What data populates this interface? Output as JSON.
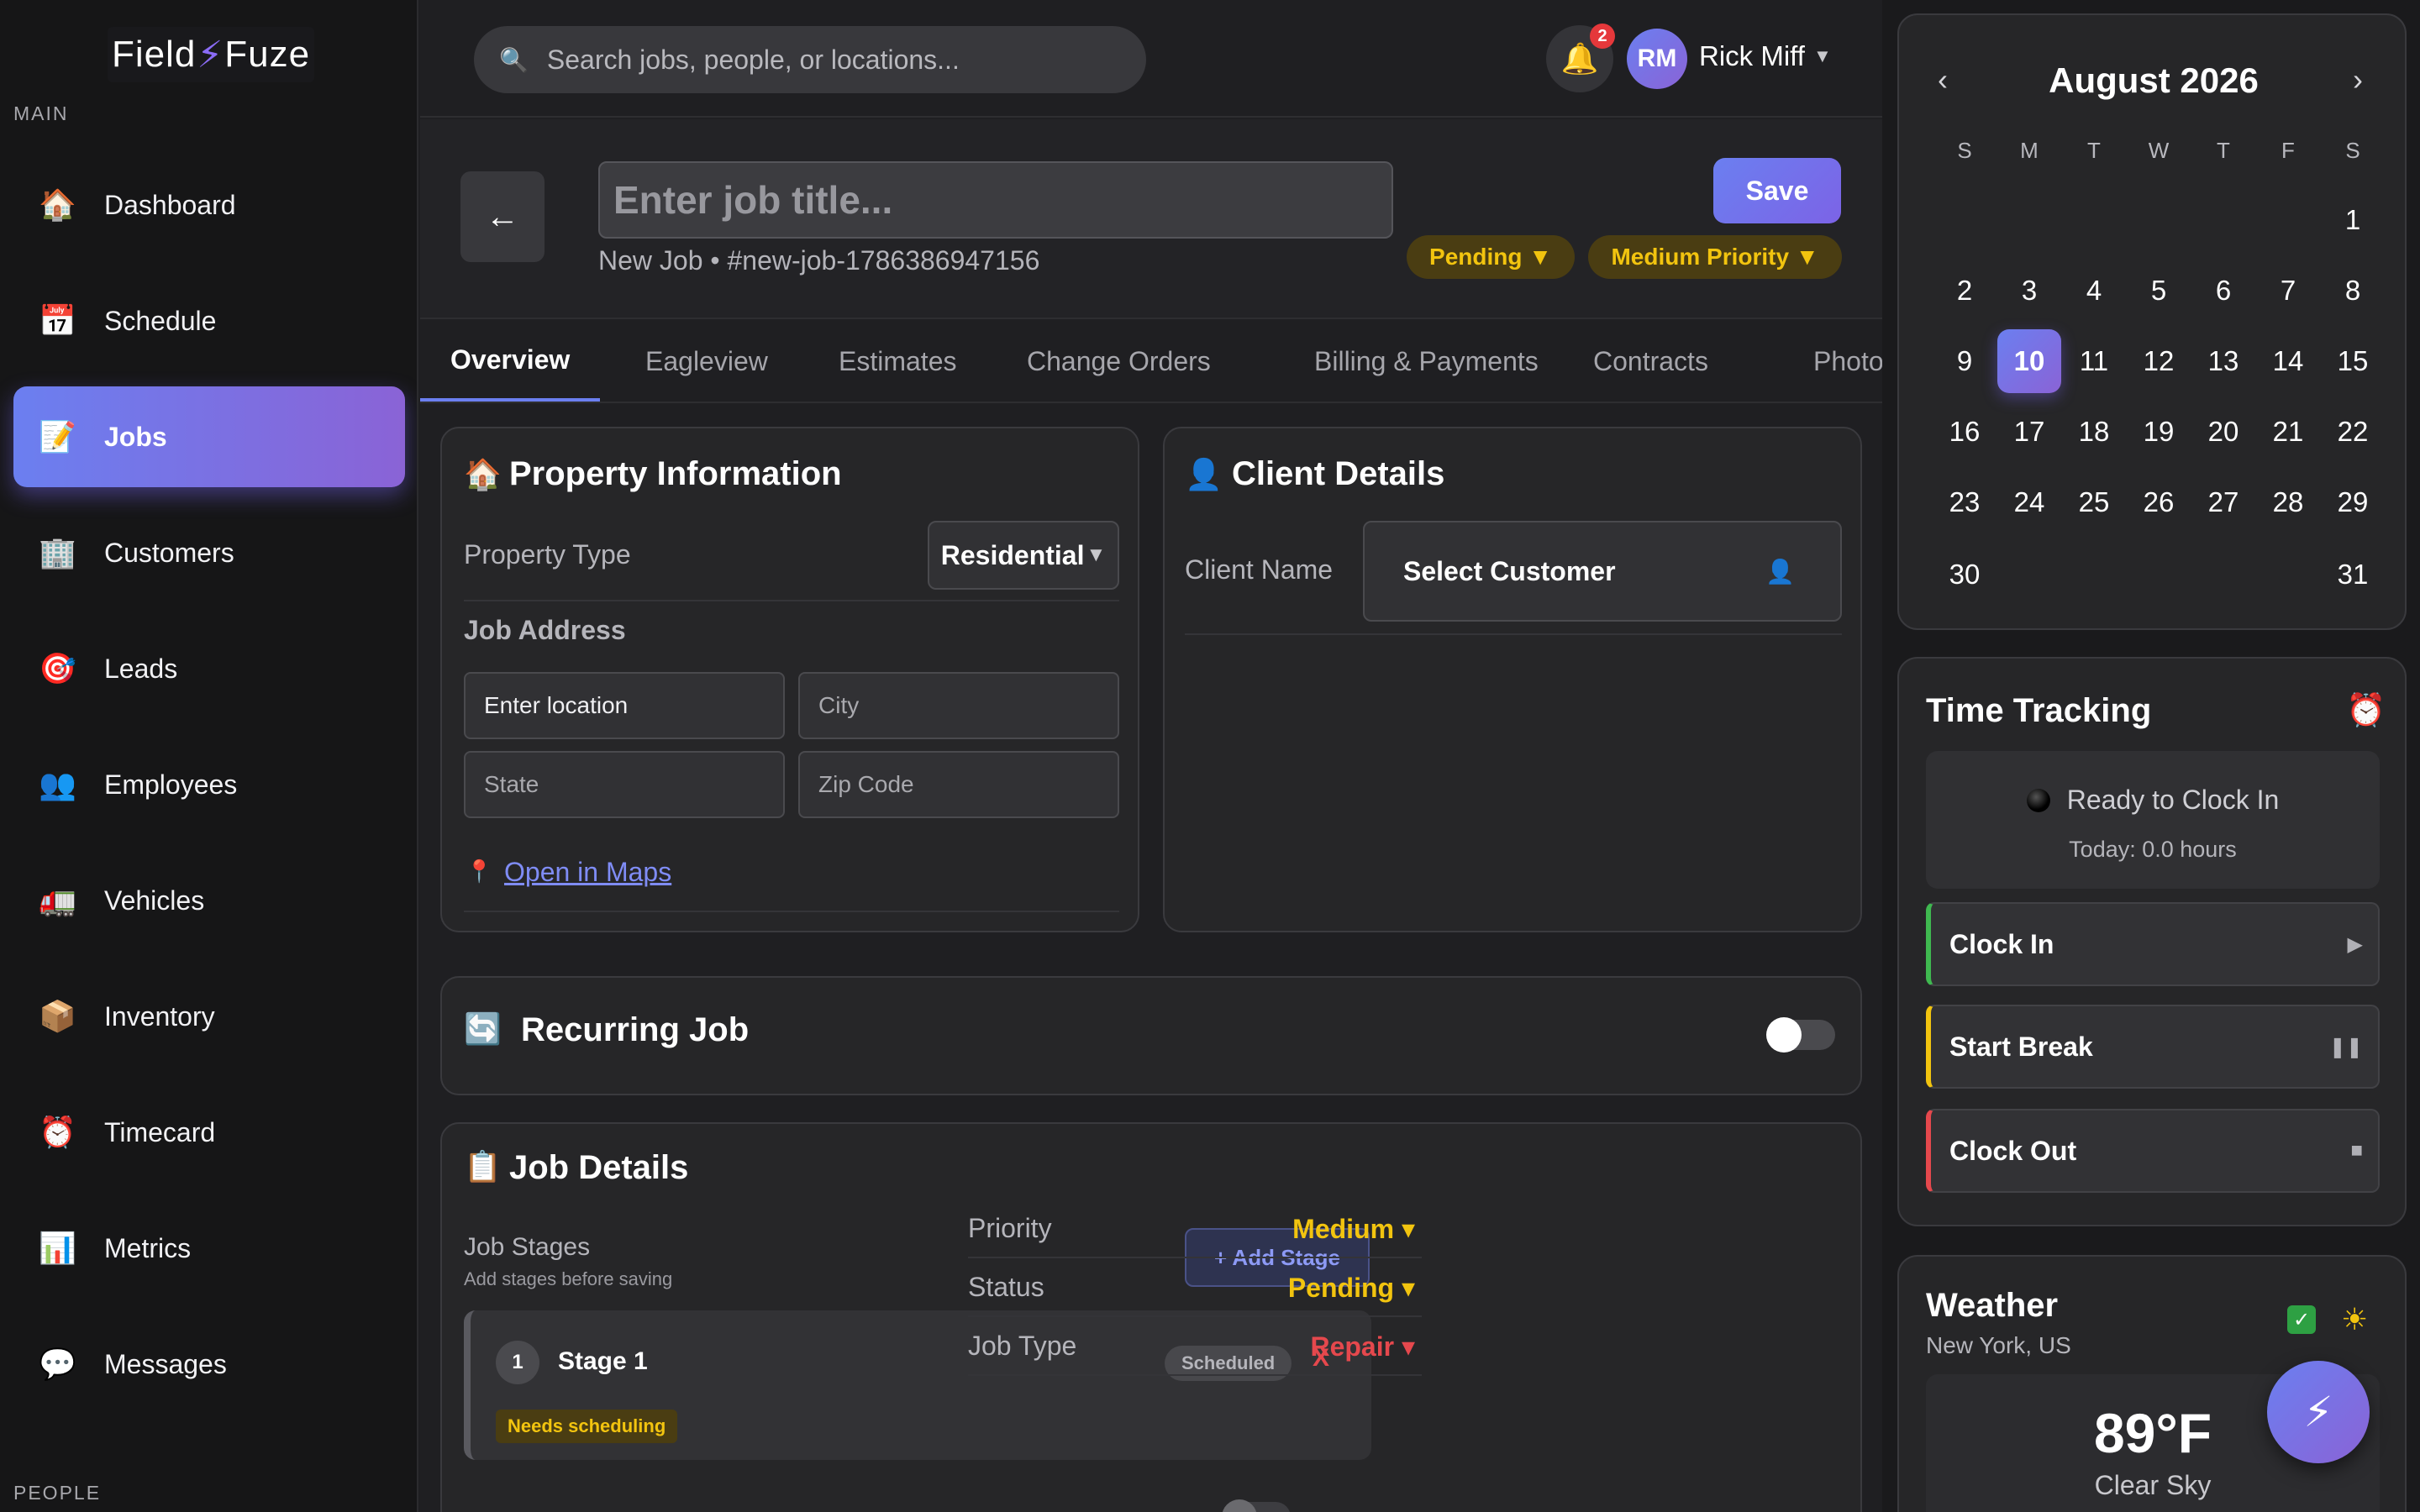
{
  "app": {
    "logo_left": "Field",
    "logo_right": "Fuze",
    "accent": "#6b7ff0",
    "accent_end": "#8a63d6"
  },
  "sidebar": {
    "section_main": "MAIN",
    "section_people": "PEOPLE",
    "items": [
      {
        "label": "Dashboard",
        "icon": "🏠",
        "icon_name": "house-icon"
      },
      {
        "label": "Schedule",
        "icon": "📅",
        "icon_name": "calendar-icon"
      },
      {
        "label": "Jobs",
        "icon": "📝",
        "icon_name": "memo-icon",
        "active": true
      },
      {
        "label": "Customers",
        "icon": "🏢",
        "icon_name": "office-building-icon"
      },
      {
        "label": "Leads",
        "icon": "🎯",
        "icon_name": "target-icon"
      },
      {
        "label": "Employees",
        "icon": "👥",
        "icon_name": "people-icon"
      },
      {
        "label": "Vehicles",
        "icon": "🚛",
        "icon_name": "truck-icon"
      },
      {
        "label": "Inventory",
        "icon": "📦",
        "icon_name": "package-icon"
      },
      {
        "label": "Timecard",
        "icon": "⏰",
        "icon_name": "alarm-clock-icon"
      },
      {
        "label": "Metrics",
        "icon": "📊",
        "icon_name": "bar-chart-icon"
      },
      {
        "label": "Messages",
        "icon": "💬",
        "icon_name": "speech-bubble-icon"
      }
    ]
  },
  "topbar": {
    "search_placeholder": "Search jobs, people, or locations...",
    "notification_count": "2",
    "avatar_initials": "RM",
    "user_name": "Rick Miff"
  },
  "job": {
    "title_placeholder": "Enter job title...",
    "subtitle": "New Job • #new-job-1786386947156",
    "save_label": "Save",
    "status_pill": "Pending ▼",
    "priority_pill": "Medium Priority ▼"
  },
  "tabs": [
    "Overview",
    "Eagleview",
    "Estimates",
    "Change Orders",
    "Billing & Payments",
    "Contracts",
    "Photos"
  ],
  "property": {
    "title": "Property Information",
    "type_label": "Property Type",
    "type_value": "Residential",
    "address_label": "Job Address",
    "location_placeholder": "Enter location",
    "city_placeholder": "City",
    "state_placeholder": "State",
    "zip_placeholder": "Zip Code",
    "maps_link": "Open in Maps"
  },
  "client": {
    "title": "Client Details",
    "name_label": "Client Name",
    "select_label": "Select Customer"
  },
  "recurring": {
    "title": "Recurring Job",
    "enabled": false
  },
  "job_details": {
    "title": "Job Details",
    "stages_label": "Job Stages",
    "stages_hint": "Add stages before saving",
    "add_stage": "+ Add Stage",
    "stage": {
      "number": "1",
      "name": "Stage 1",
      "status": "Scheduled",
      "remove": "X",
      "tag": "Needs scheduling"
    },
    "meta": [
      {
        "label": "Priority",
        "value": "Medium ▾",
        "color": "#f2c40f"
      },
      {
        "label": "Status",
        "value": "Pending ▾",
        "color": "#f2c40f"
      },
      {
        "label": "Job Type",
        "value": "Repair ▾",
        "color": "#e5484d"
      }
    ]
  },
  "calendar": {
    "month_label": "August 2026",
    "prev": "‹",
    "next": "›",
    "weekdays": [
      "S",
      "M",
      "T",
      "W",
      "T",
      "F",
      "S"
    ],
    "today": 10
  },
  "time_tracking": {
    "title": "Time Tracking",
    "status_text": "Ready to Clock In",
    "today_text": "Today: 0.0 hours",
    "actions": [
      {
        "label": "Clock In",
        "glyph": "▶",
        "color": "#3fb950"
      },
      {
        "label": "Start Break",
        "glyph": "❚❚",
        "color": "#f2c40f"
      },
      {
        "label": "Clock Out",
        "glyph": "■",
        "color": "#e5484d"
      }
    ]
  },
  "weather": {
    "title": "Weather",
    "location": "New York, US",
    "temperature": "89°F",
    "condition": "Clear Sky"
  }
}
